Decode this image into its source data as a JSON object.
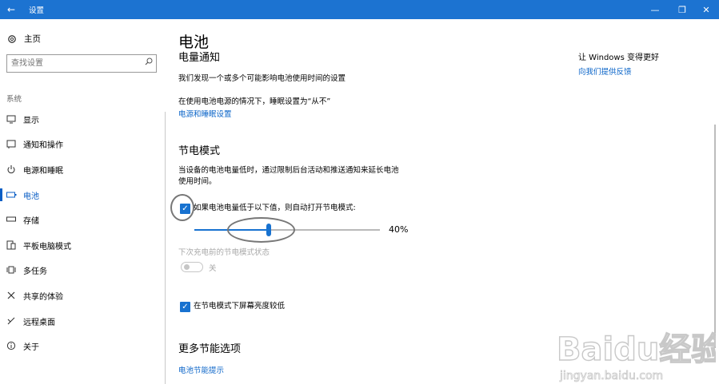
{
  "titlebar": {
    "back_glyph": "←",
    "title": "设置",
    "minimize_glyph": "—",
    "maximize_glyph": "❐",
    "close_glyph": "✕"
  },
  "sidebar": {
    "home_label": "主页",
    "search_placeholder": "查找设置",
    "section_label": "系统",
    "items": [
      {
        "label": "显示",
        "icon": "monitor-icon"
      },
      {
        "label": "通知和操作",
        "icon": "notification-icon"
      },
      {
        "label": "电源和睡眠",
        "icon": "power-icon"
      },
      {
        "label": "电池",
        "icon": "battery-icon",
        "active": true
      },
      {
        "label": "存储",
        "icon": "storage-icon"
      },
      {
        "label": "平板电脑模式",
        "icon": "tablet-mode-icon"
      },
      {
        "label": "多任务",
        "icon": "multitask-icon"
      },
      {
        "label": "共享的体验",
        "icon": "share-icon"
      },
      {
        "label": "远程桌面",
        "icon": "remote-desktop-icon"
      },
      {
        "label": "关于",
        "icon": "info-icon"
      }
    ]
  },
  "main": {
    "title": "电池",
    "notify_heading": "电量通知",
    "notify_text": "我们发现一个或多个可能影响电池使用时间的设置",
    "sleep_text": "在使用电池电源的情况下，睡眠设置为“从不”",
    "power_sleep_link": "电源和睡眠设置",
    "saver_heading": "节电模式",
    "saver_desc_line1": "当设备的电池电量低时，通过限制后台活动和推送通知来延长电池",
    "saver_desc_line2": "使用时间。",
    "auto_on_label": "如果电池电量低于以下值，则自动打开节电模式:",
    "auto_on_checked": true,
    "threshold_percent": 40,
    "threshold_label": "40%",
    "status_label": "下次充电前的节电模式状态",
    "status_toggle_label": "关",
    "status_toggle_on": false,
    "lower_brightness_label": "在节电模式下屏幕亮度较低",
    "lower_brightness_checked": true,
    "more_heading": "更多节能选项",
    "battery_tips_link": "电池节能提示"
  },
  "right": {
    "heading": "让 Windows 变得更好",
    "feedback_link": "向我们提供反馈"
  },
  "watermark": {
    "brand": "Baidu经验",
    "url": "jingyan.baidu.com"
  },
  "colors": {
    "titlebar": "#1c73d1",
    "accent": "#1872d0",
    "link": "#0a64c8"
  }
}
